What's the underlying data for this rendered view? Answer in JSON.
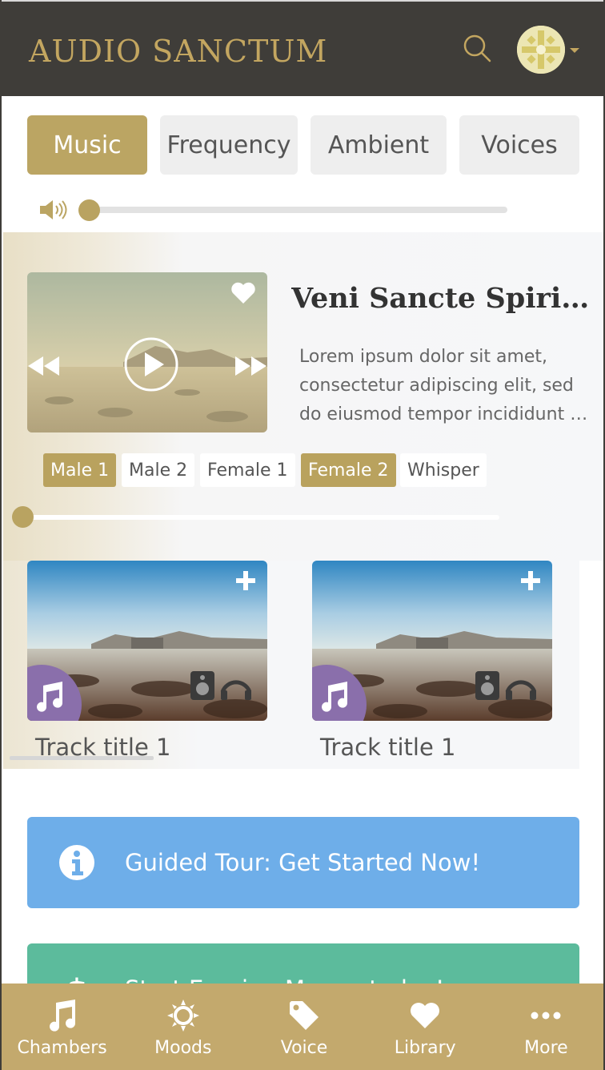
{
  "header": {
    "logo": "AUDIO SANCTUM"
  },
  "tabs": [
    {
      "label": "Music",
      "active": true
    },
    {
      "label": "Frequency",
      "active": false
    },
    {
      "label": "Ambient",
      "active": false
    },
    {
      "label": "Voices",
      "active": false
    }
  ],
  "volume": {
    "level": 0.0
  },
  "featured": {
    "title": "Veni Sancte Spiritus",
    "description": "Lorem ipsum dolor sit amet, consectetur adipiscing elit, sed do eiusmod tempor incididunt ut labore et dolore magna aliqua.",
    "voices": [
      {
        "label": "Male 1",
        "active": true
      },
      {
        "label": "Male 2",
        "active": false
      },
      {
        "label": "Female 1",
        "active": false
      },
      {
        "label": "Female 2",
        "active": true
      },
      {
        "label": "Whisper",
        "active": false
      }
    ],
    "progress": 0.0
  },
  "tracks": [
    {
      "title": "Track title 1"
    },
    {
      "title": "Track title 1"
    }
  ],
  "banners": {
    "guided_tour": "Guided Tour: Get Started Now!",
    "money": "Start Earning Money today!"
  },
  "bottom_nav": [
    {
      "label": "Chambers",
      "icon": "music-note-icon"
    },
    {
      "label": "Moods",
      "icon": "sun-icon"
    },
    {
      "label": "Voice",
      "icon": "tag-icon"
    },
    {
      "label": "Library",
      "icon": "heart-icon"
    },
    {
      "label": "More",
      "icon": "more-dots-icon"
    }
  ],
  "colors": {
    "header_bg": "#3f3d39",
    "gold": "#c3a660",
    "tab_active": "#bba563",
    "info_banner": "#6eaee9",
    "money_banner": "#5cbb9c",
    "bottom_nav_bg": "#c3a96d",
    "music_badge": "#8a6fab"
  }
}
